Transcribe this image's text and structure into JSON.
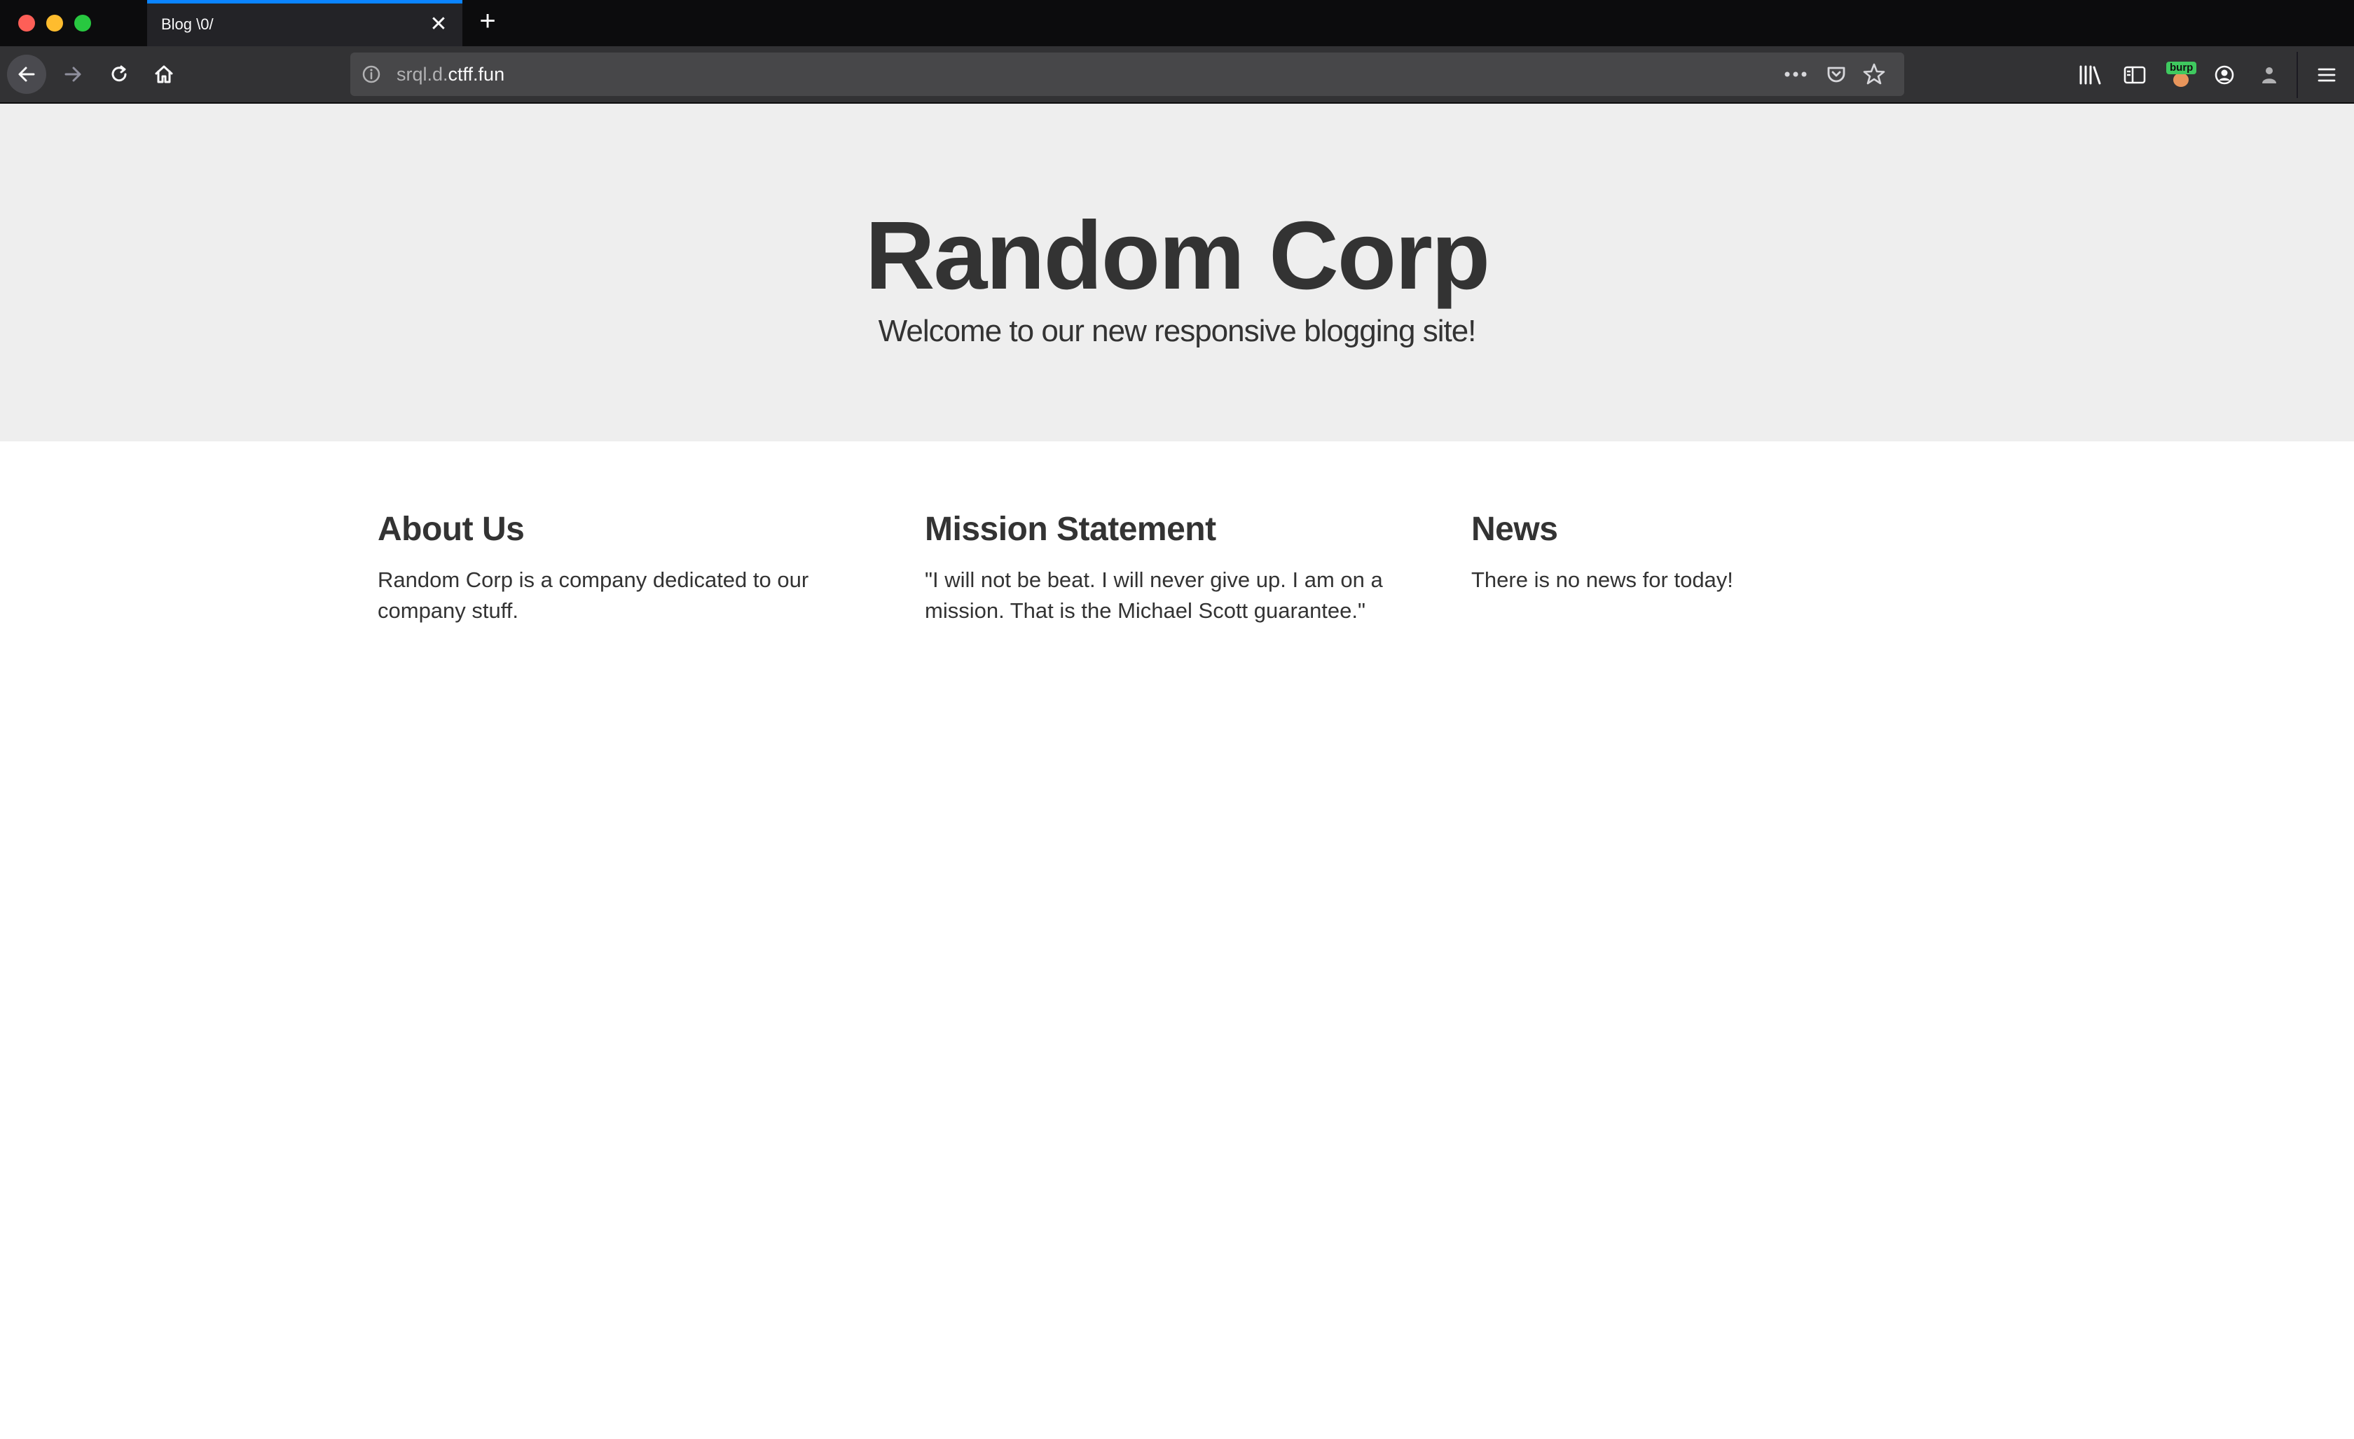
{
  "browser": {
    "tab_title": "Blog \\0/",
    "tab_close_glyph": "✕",
    "new_tab_glyph": "+",
    "url_prefix": "srql.d.",
    "url_domain": "ctff.fun",
    "burp_label": "burp"
  },
  "page": {
    "hero": {
      "title": "Random Corp",
      "subtitle": "Welcome to our new responsive blogging site!"
    },
    "columns": [
      {
        "heading": "About Us",
        "text": "Random Corp is a company dedicated to our company stuff."
      },
      {
        "heading": "Mission Statement",
        "text": "\"I will not be beat. I will never give up. I am on a mission. That is the Michael Scott guarantee.\""
      },
      {
        "heading": "News",
        "text": "There is no news for today!"
      }
    ]
  },
  "colors": {
    "hero_bg": "#eeeeee",
    "text": "#333333",
    "tab_accent": "#0a84ff"
  }
}
